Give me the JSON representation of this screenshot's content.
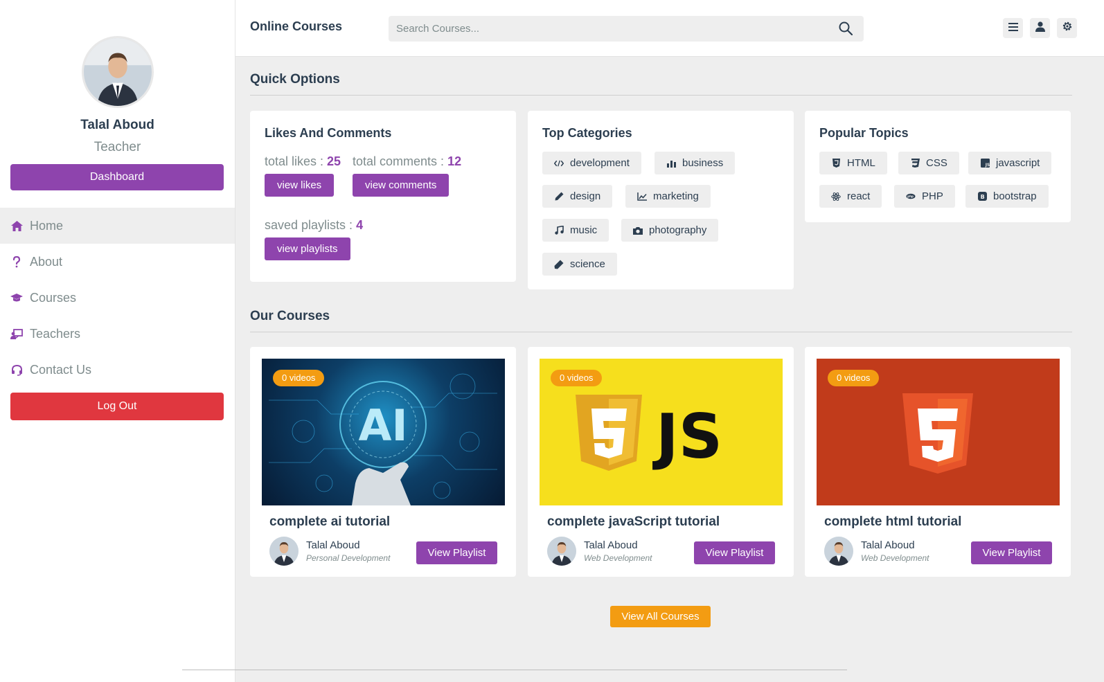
{
  "sidebar": {
    "profile": {
      "name": "Talal Aboud",
      "role": "Teacher"
    },
    "dashboard_label": "Dashboard",
    "items": [
      {
        "label": "Home",
        "icon": "home-icon"
      },
      {
        "label": "About",
        "icon": "question-icon"
      },
      {
        "label": "Courses",
        "icon": "graduation-cap-icon"
      },
      {
        "label": "Teachers",
        "icon": "teacher-icon"
      },
      {
        "label": "Contact Us",
        "icon": "headset-icon"
      }
    ],
    "logout_label": "Log Out"
  },
  "header": {
    "logo": "Online Courses",
    "search_placeholder": "Search Courses..."
  },
  "quick_options": {
    "title": "Quick Options",
    "likes": {
      "title": "Likes And Comments",
      "likes_label": "total likes : ",
      "likes_value": "25",
      "comments_label": "total comments : ",
      "comments_value": "12",
      "view_likes": "view likes",
      "view_comments": "view comments",
      "saved_label": "saved playlists : ",
      "saved_value": "4",
      "view_playlists": "view playlists"
    },
    "categories": {
      "title": "Top Categories",
      "items": [
        {
          "label": "development",
          "icon": "code-icon"
        },
        {
          "label": "business",
          "icon": "bar-chart-icon"
        },
        {
          "label": "design",
          "icon": "pen-icon"
        },
        {
          "label": "marketing",
          "icon": "line-chart-icon"
        },
        {
          "label": "music",
          "icon": "music-icon"
        },
        {
          "label": "photography",
          "icon": "camera-icon"
        },
        {
          "label": "science",
          "icon": "flask-icon"
        }
      ]
    },
    "topics": {
      "title": "Popular Topics",
      "items": [
        {
          "label": "HTML",
          "icon": "html5-icon"
        },
        {
          "label": "CSS",
          "icon": "css3-icon"
        },
        {
          "label": "javascript",
          "icon": "js-icon"
        },
        {
          "label": "react",
          "icon": "react-icon"
        },
        {
          "label": "PHP",
          "icon": "php-icon"
        },
        {
          "label": "bootstrap",
          "icon": "bootstrap-icon"
        }
      ]
    }
  },
  "courses": {
    "title": "Our Courses",
    "items": [
      {
        "badge": "0 videos",
        "title": "complete ai tutorial",
        "author": "Talal Aboud",
        "subtitle": "Personal Development",
        "button": "View Playlist",
        "thumb_label": "AI"
      },
      {
        "badge": "0 videos",
        "title": "complete javaScript tutorial",
        "author": "Talal Aboud",
        "subtitle": "Web Development",
        "button": "View Playlist",
        "thumb_label": "JS"
      },
      {
        "badge": "0 videos",
        "title": "complete html tutorial",
        "author": "Talal Aboud",
        "subtitle": "Web Development",
        "button": "View Playlist",
        "thumb_label": ""
      }
    ],
    "view_all": "View All Courses"
  },
  "colors": {
    "accent": "#8e44ad",
    "danger": "#e0373f",
    "orange": "#f39c12"
  }
}
